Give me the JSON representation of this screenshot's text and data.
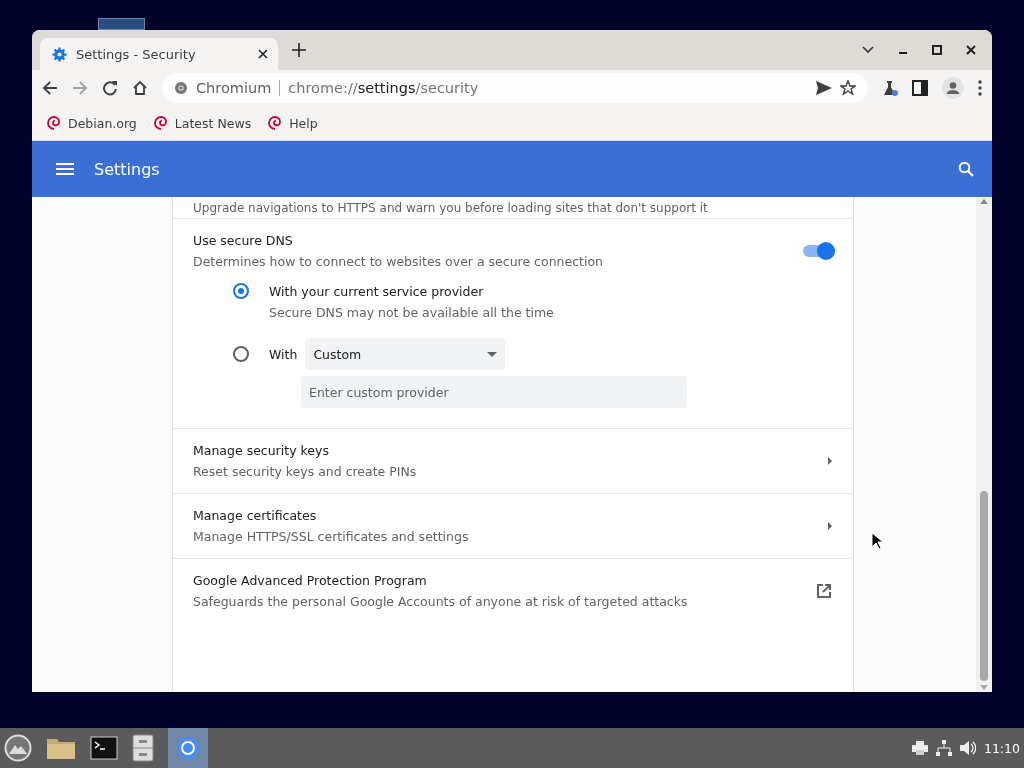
{
  "tab": {
    "title": "Settings - Security",
    "selected": true
  },
  "address_bar": {
    "site": "Chromium",
    "url": "chrome://**settings**/security"
  },
  "bookmarks": [
    "Debian.org",
    "Latest News",
    "Help"
  ],
  "header": {
    "title": "Settings"
  },
  "cut_text": "Upgrade navigations to HTTPS and warn you before loading sites that don't support it",
  "secure_dns": {
    "title": "Use secure DNS",
    "description": "Determines how to connect to websites over a secure connection",
    "on": true,
    "options": [
      {
        "label": "With your current service provider",
        "description": "Secure DNS may not be available all the time",
        "selected": true
      },
      {
        "label": "With",
        "dropdown": "Custom",
        "placeholder": "Enter custom provider",
        "selected": false
      }
    ]
  },
  "rows": [
    {
      "title": "Manage security keys",
      "description": "Reset security keys and create PINs",
      "kind": "arrow"
    },
    {
      "title": "Manage certificates",
      "description": "Manage HTTPS/SSL certificates and settings",
      "kind": "arrow"
    },
    {
      "title": "Google Advanced Protection Program",
      "description": "Safeguards the personal Google Accounts of anyone at risk of targeted attacks",
      "kind": "external"
    }
  ],
  "taskbar": {
    "clock": "11:10"
  }
}
